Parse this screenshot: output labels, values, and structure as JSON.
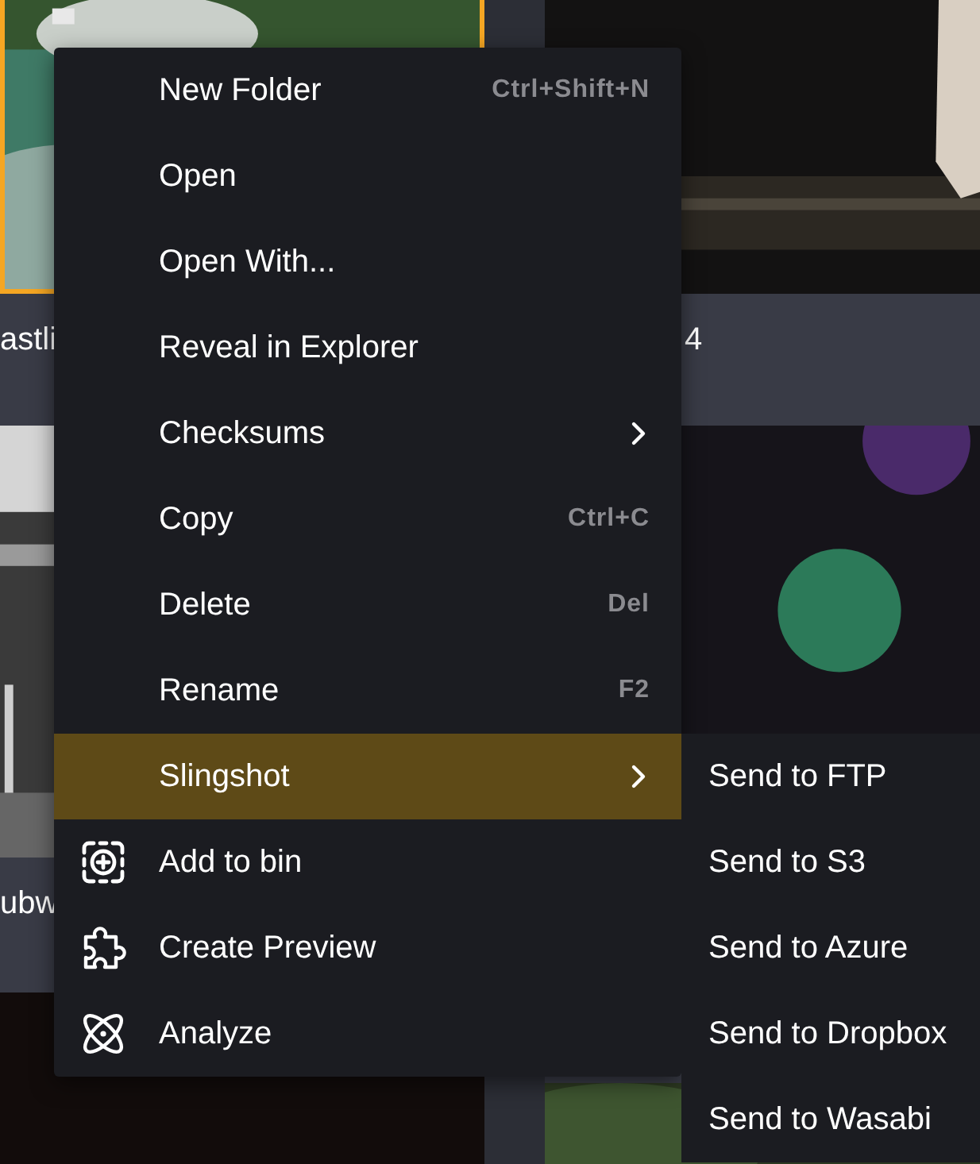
{
  "thumbnails": {
    "left": [
      {
        "kind": "landscape",
        "caption": "astli",
        "selected": true
      },
      {
        "kind": "subway",
        "caption": "ubw",
        "selected": false
      },
      {
        "kind": "fire",
        "selected": false
      }
    ],
    "right": [
      {
        "kind": "stage",
        "caption": "4",
        "selected": false
      },
      {
        "kind": "bokeh",
        "selected": false
      },
      {
        "kind": "grass",
        "selected": false
      }
    ]
  },
  "context_menu": {
    "items": [
      {
        "kind": "plain",
        "label": "New Folder",
        "shortcut": "Ctrl+Shift+N",
        "highlighted": false
      },
      {
        "kind": "plain",
        "label": "Open",
        "highlighted": false
      },
      {
        "kind": "plain",
        "label": "Open With...",
        "highlighted": false
      },
      {
        "kind": "plain",
        "label": "Reveal in Explorer",
        "highlighted": false
      },
      {
        "kind": "submenu",
        "label": "Checksums",
        "highlighted": false
      },
      {
        "kind": "plain",
        "label": "Copy",
        "shortcut": "Ctrl+C",
        "highlighted": false
      },
      {
        "kind": "plain",
        "label": "Delete",
        "shortcut": "Del",
        "highlighted": false
      },
      {
        "kind": "plain",
        "label": "Rename",
        "shortcut": "F2",
        "highlighted": false
      },
      {
        "kind": "submenu",
        "label": "Slingshot",
        "highlighted": true
      },
      {
        "kind": "add",
        "label": "Add to bin",
        "highlighted": false
      },
      {
        "kind": "puzzle",
        "label": "Create Preview",
        "highlighted": false
      },
      {
        "kind": "atom",
        "label": "Analyze",
        "highlighted": false
      }
    ]
  },
  "submenu": {
    "items": [
      {
        "label": "Send to FTP"
      },
      {
        "label": "Send to S3"
      },
      {
        "label": "Send to Azure"
      },
      {
        "label": "Send to Dropbox"
      },
      {
        "label": "Send to Wasabi"
      }
    ]
  }
}
